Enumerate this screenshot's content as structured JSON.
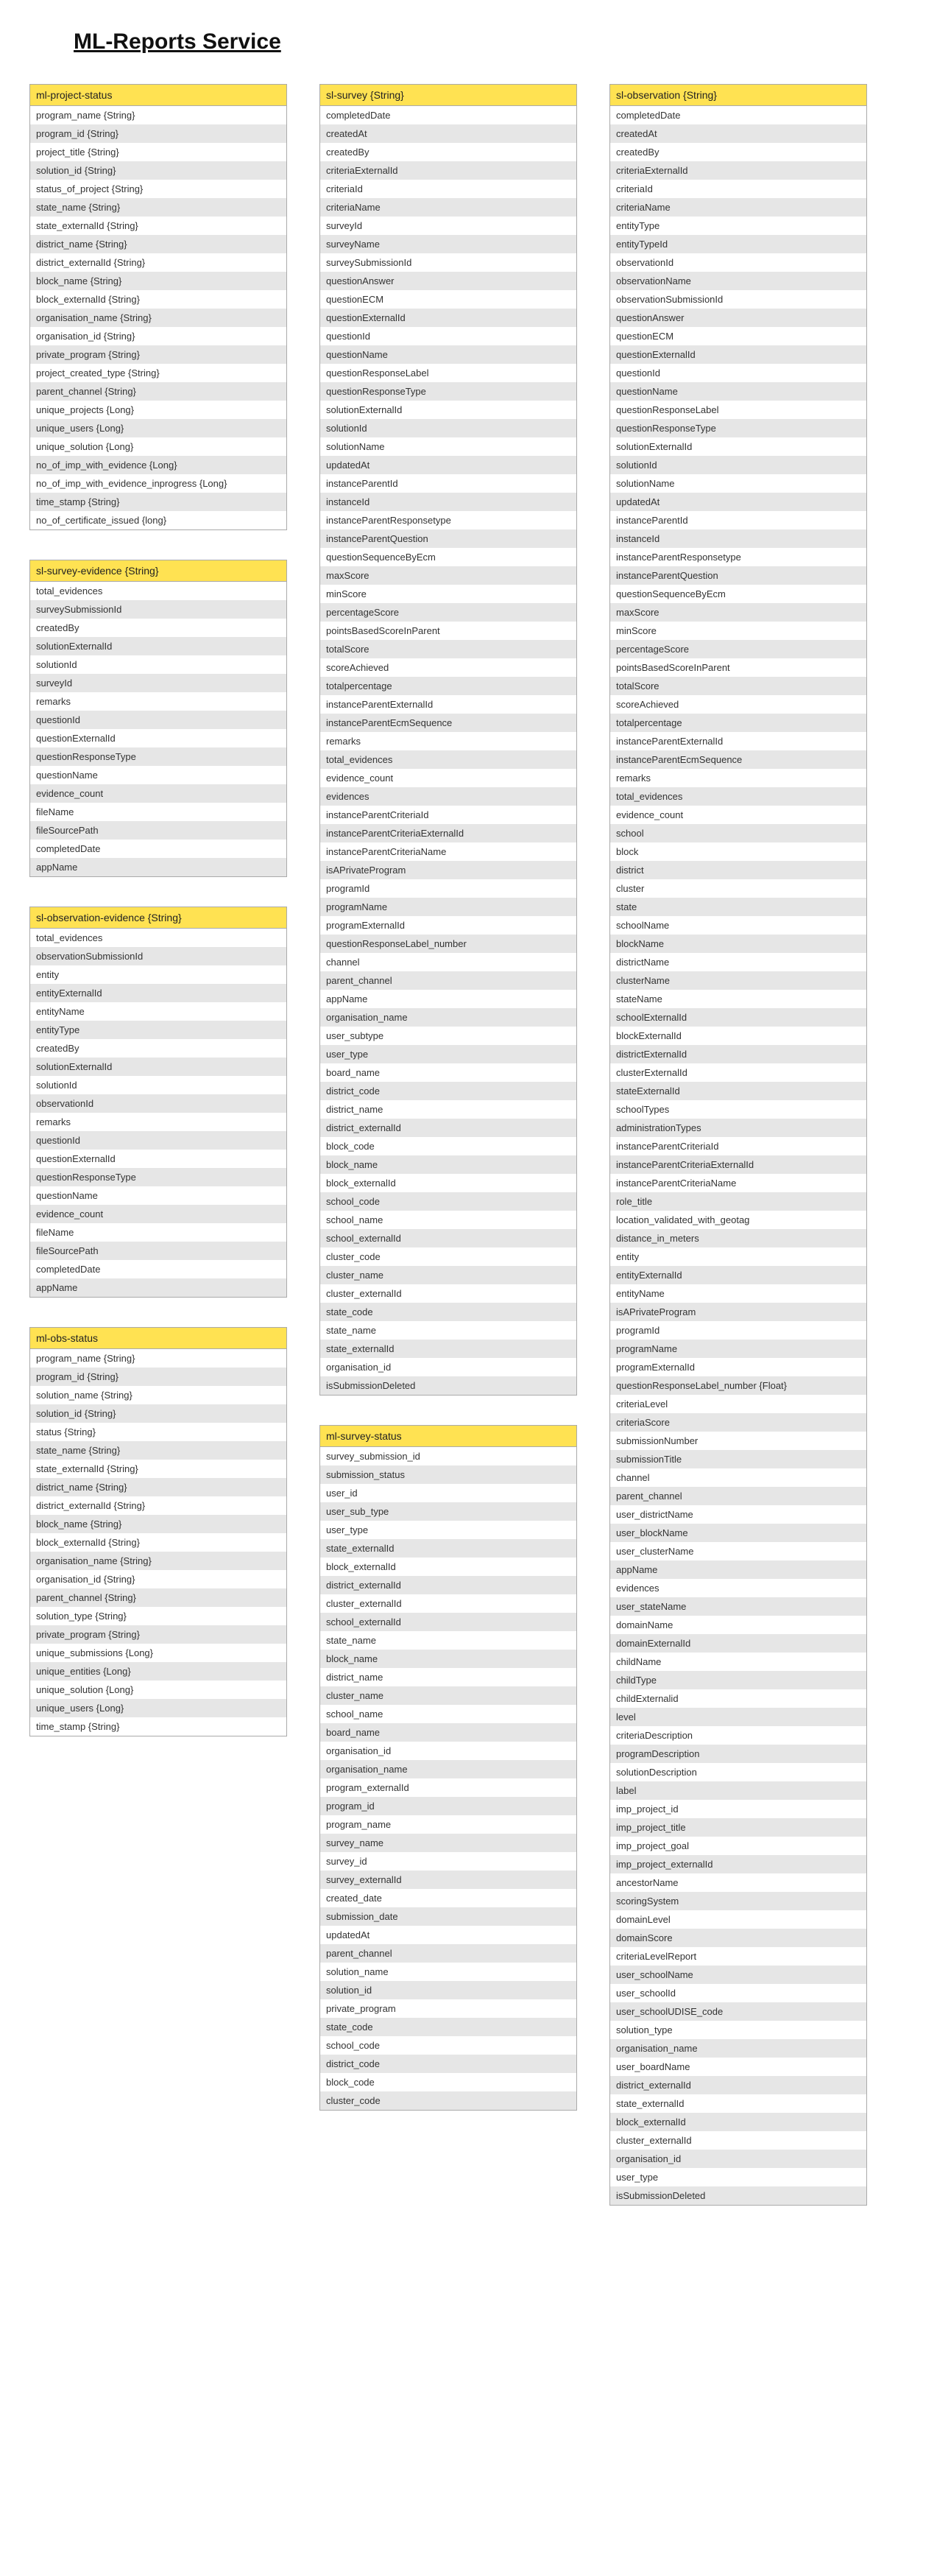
{
  "title": "ML-Reports Service",
  "columns": [
    {
      "tables": [
        {
          "name": "ml-project-status",
          "rows": [
            "program_name {String}",
            "program_id {String}",
            "project_title {String}",
            "solution_id {String}",
            "status_of_project {String}",
            "state_name {String}",
            "state_externalId {String}",
            "district_name {String}",
            "district_externalId {String}",
            "block_name {String}",
            "block_externalId {String}",
            "organisation_name {String}",
            "organisation_id {String}",
            "private_program {String}",
            "project_created_type {String}",
            "parent_channel {String}",
            "unique_projects {Long}",
            "unique_users {Long}",
            "unique_solution {Long}",
            "no_of_imp_with_evidence {Long}",
            "no_of_imp_with_evidence_inprogress {Long}",
            "time_stamp {String}",
            "no_of_certificate_issued {long}"
          ]
        },
        {
          "name": "sl-survey-evidence {String}",
          "rows": [
            "total_evidences",
            "surveySubmissionId",
            "createdBy",
            "solutionExternalId",
            "solutionId",
            "surveyId",
            "remarks",
            "questionId",
            "questionExternalId",
            "questionResponseType",
            "questionName",
            "evidence_count",
            "fileName",
            "fileSourcePath",
            "completedDate",
            "appName"
          ]
        },
        {
          "name": "sl-observation-evidence {String}",
          "rows": [
            "total_evidences",
            "observationSubmissionId",
            "entity",
            "entityExternalId",
            "entityName",
            "entityType",
            "createdBy",
            "solutionExternalId",
            "solutionId",
            "observationId",
            "remarks",
            "questionId",
            "questionExternalId",
            "questionResponseType",
            "questionName",
            "evidence_count",
            "fileName",
            "fileSourcePath",
            "completedDate",
            "appName"
          ]
        },
        {
          "name": "ml-obs-status",
          "rows": [
            "program_name {String}",
            "program_id {String}",
            "solution_name {String}",
            "solution_id {String}",
            "status {String}",
            "state_name {String}",
            "state_externalId {String}",
            "district_name {String}",
            "district_externalId {String}",
            "block_name {String}",
            "block_externalId {String}",
            "organisation_name {String}",
            "organisation_id {String}",
            "parent_channel {String}",
            "solution_type {String}",
            "private_program {String}",
            "unique_submissions {Long}",
            "unique_entities {Long}",
            "unique_solution {Long}",
            "unique_users {Long}",
            "time_stamp {String}"
          ]
        }
      ]
    },
    {
      "tables": [
        {
          "name": "sl-survey {String}",
          "rows": [
            "completedDate",
            "createdAt",
            "createdBy",
            "criteriaExternalId",
            "criteriaId",
            "criteriaName",
            "surveyId",
            "surveyName",
            "surveySubmissionId",
            "questionAnswer",
            "questionECM",
            "questionExternalId",
            "questionId",
            "questionName",
            "questionResponseLabel",
            "questionResponseType",
            "solutionExternalId",
            "solutionId",
            "solutionName",
            "updatedAt",
            "instanceParentId",
            "instanceId",
            "instanceParentResponsetype",
            "instanceParentQuestion",
            "questionSequenceByEcm",
            "maxScore",
            "minScore",
            "percentageScore",
            "pointsBasedScoreInParent",
            "totalScore",
            "scoreAchieved",
            "totalpercentage",
            "instanceParentExternalId",
            "instanceParentEcmSequence",
            "remarks",
            "total_evidences",
            "evidence_count",
            "evidences",
            "instanceParentCriteriaId",
            "instanceParentCriteriaExternalId",
            "instanceParentCriteriaName",
            "isAPrivateProgram",
            "programId",
            "programName",
            "programExternalId",
            "questionResponseLabel_number",
            "channel",
            "parent_channel",
            "appName",
            "organisation_name",
            "user_subtype",
            "user_type",
            "board_name",
            "district_code",
            "district_name",
            "district_externalId",
            "block_code",
            "block_name",
            "block_externalId",
            "school_code",
            "school_name",
            "school_externalId",
            "cluster_code",
            "cluster_name",
            "cluster_externalId",
            "state_code",
            "state_name",
            "state_externalId",
            "organisation_id",
            "isSubmissionDeleted"
          ]
        },
        {
          "name": "ml-survey-status",
          "rows": [
            "survey_submission_id",
            "submission_status",
            "user_id",
            "user_sub_type",
            "user_type",
            "state_externalId",
            "block_externalId",
            "district_externalId",
            "cluster_externalId",
            "school_externalId",
            "state_name",
            "block_name",
            "district_name",
            "cluster_name",
            "school_name",
            "board_name",
            "organisation_id",
            "organisation_name",
            "program_externalId",
            "program_id",
            "program_name",
            "survey_name",
            "survey_id",
            "survey_externalId",
            "created_date",
            "submission_date",
            "updatedAt",
            "parent_channel",
            "solution_name",
            "solution_id",
            "private_program",
            "state_code",
            "school_code",
            "district_code",
            "block_code",
            "cluster_code"
          ]
        }
      ]
    },
    {
      "tables": [
        {
          "name": "sl-observation {String}",
          "rows": [
            "completedDate",
            "createdAt",
            "createdBy",
            "criteriaExternalId",
            "criteriaId",
            "criteriaName",
            "entityType",
            "entityTypeId",
            "observationId",
            "observationName",
            "observationSubmissionId",
            "questionAnswer",
            "questionECM",
            "questionExternalId",
            "questionId",
            "questionName",
            "questionResponseLabel",
            "questionResponseType",
            "solutionExternalId",
            "solutionId",
            "solutionName",
            "updatedAt",
            "instanceParentId",
            "instanceId",
            "instanceParentResponsetype",
            "instanceParentQuestion",
            "questionSequenceByEcm",
            "maxScore",
            "minScore",
            "percentageScore",
            "pointsBasedScoreInParent",
            "totalScore",
            "scoreAchieved",
            "totalpercentage",
            "instanceParentExternalId",
            "instanceParentEcmSequence",
            "remarks",
            "total_evidences",
            "evidence_count",
            "school",
            "block",
            "district",
            "cluster",
            "state",
            "schoolName",
            "blockName",
            "districtName",
            "clusterName",
            "stateName",
            "schoolExternalId",
            "blockExternalId",
            "districtExternalId",
            "clusterExternalId",
            "stateExternalId",
            "schoolTypes",
            "administrationTypes",
            "instanceParentCriteriaId",
            "instanceParentCriteriaExternalId",
            "instanceParentCriteriaName",
            "role_title",
            "location_validated_with_geotag",
            "distance_in_meters",
            "entity",
            "entityExternalId",
            "entityName",
            "isAPrivateProgram",
            "programId",
            "programName",
            "programExternalId",
            "questionResponseLabel_number {Float}",
            "criteriaLevel",
            "criteriaScore",
            "submissionNumber",
            "submissionTitle",
            "channel",
            "parent_channel",
            "user_districtName",
            "user_blockName",
            "user_clusterName",
            "appName",
            "evidences",
            "user_stateName",
            "domainName",
            "domainExternalId",
            "childName",
            "childType",
            "childExternalid",
            "level",
            "criteriaDescription",
            "programDescription",
            "solutionDescription",
            "label",
            "imp_project_id",
            "imp_project_title",
            "imp_project_goal",
            "imp_project_externalId",
            "ancestorName",
            "scoringSystem",
            "domainLevel",
            "domainScore",
            "criteriaLevelReport",
            "user_schoolName",
            "user_schoolId",
            "user_schoolUDISE_code",
            "solution_type",
            "organisation_name",
            "user_boardName",
            "district_externalId",
            "state_externalId",
            "block_externalId",
            "cluster_externalId",
            "organisation_id",
            "user_type",
            "isSubmissionDeleted"
          ]
        }
      ]
    }
  ]
}
